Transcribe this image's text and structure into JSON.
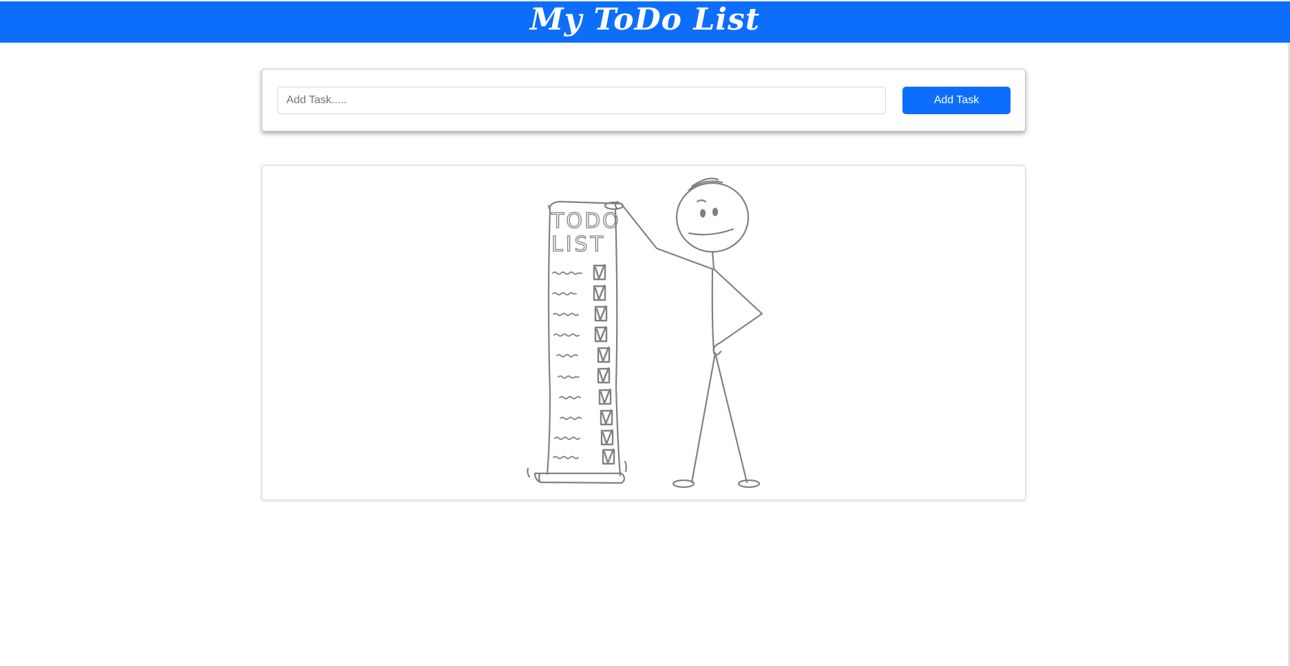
{
  "header": {
    "title": "My ToDo List",
    "background_color": "#0d6efd"
  },
  "task_form": {
    "input_placeholder": "Add Task.....",
    "input_value": "",
    "add_button_label": "Add Task",
    "button_color": "#0d6efd"
  },
  "illustration": {
    "scroll_heading_line1": "TODO",
    "scroll_heading_line2": "LIST",
    "checklist_items_checked": 10,
    "icon": "stickman-holding-todo-scroll-illustration"
  }
}
